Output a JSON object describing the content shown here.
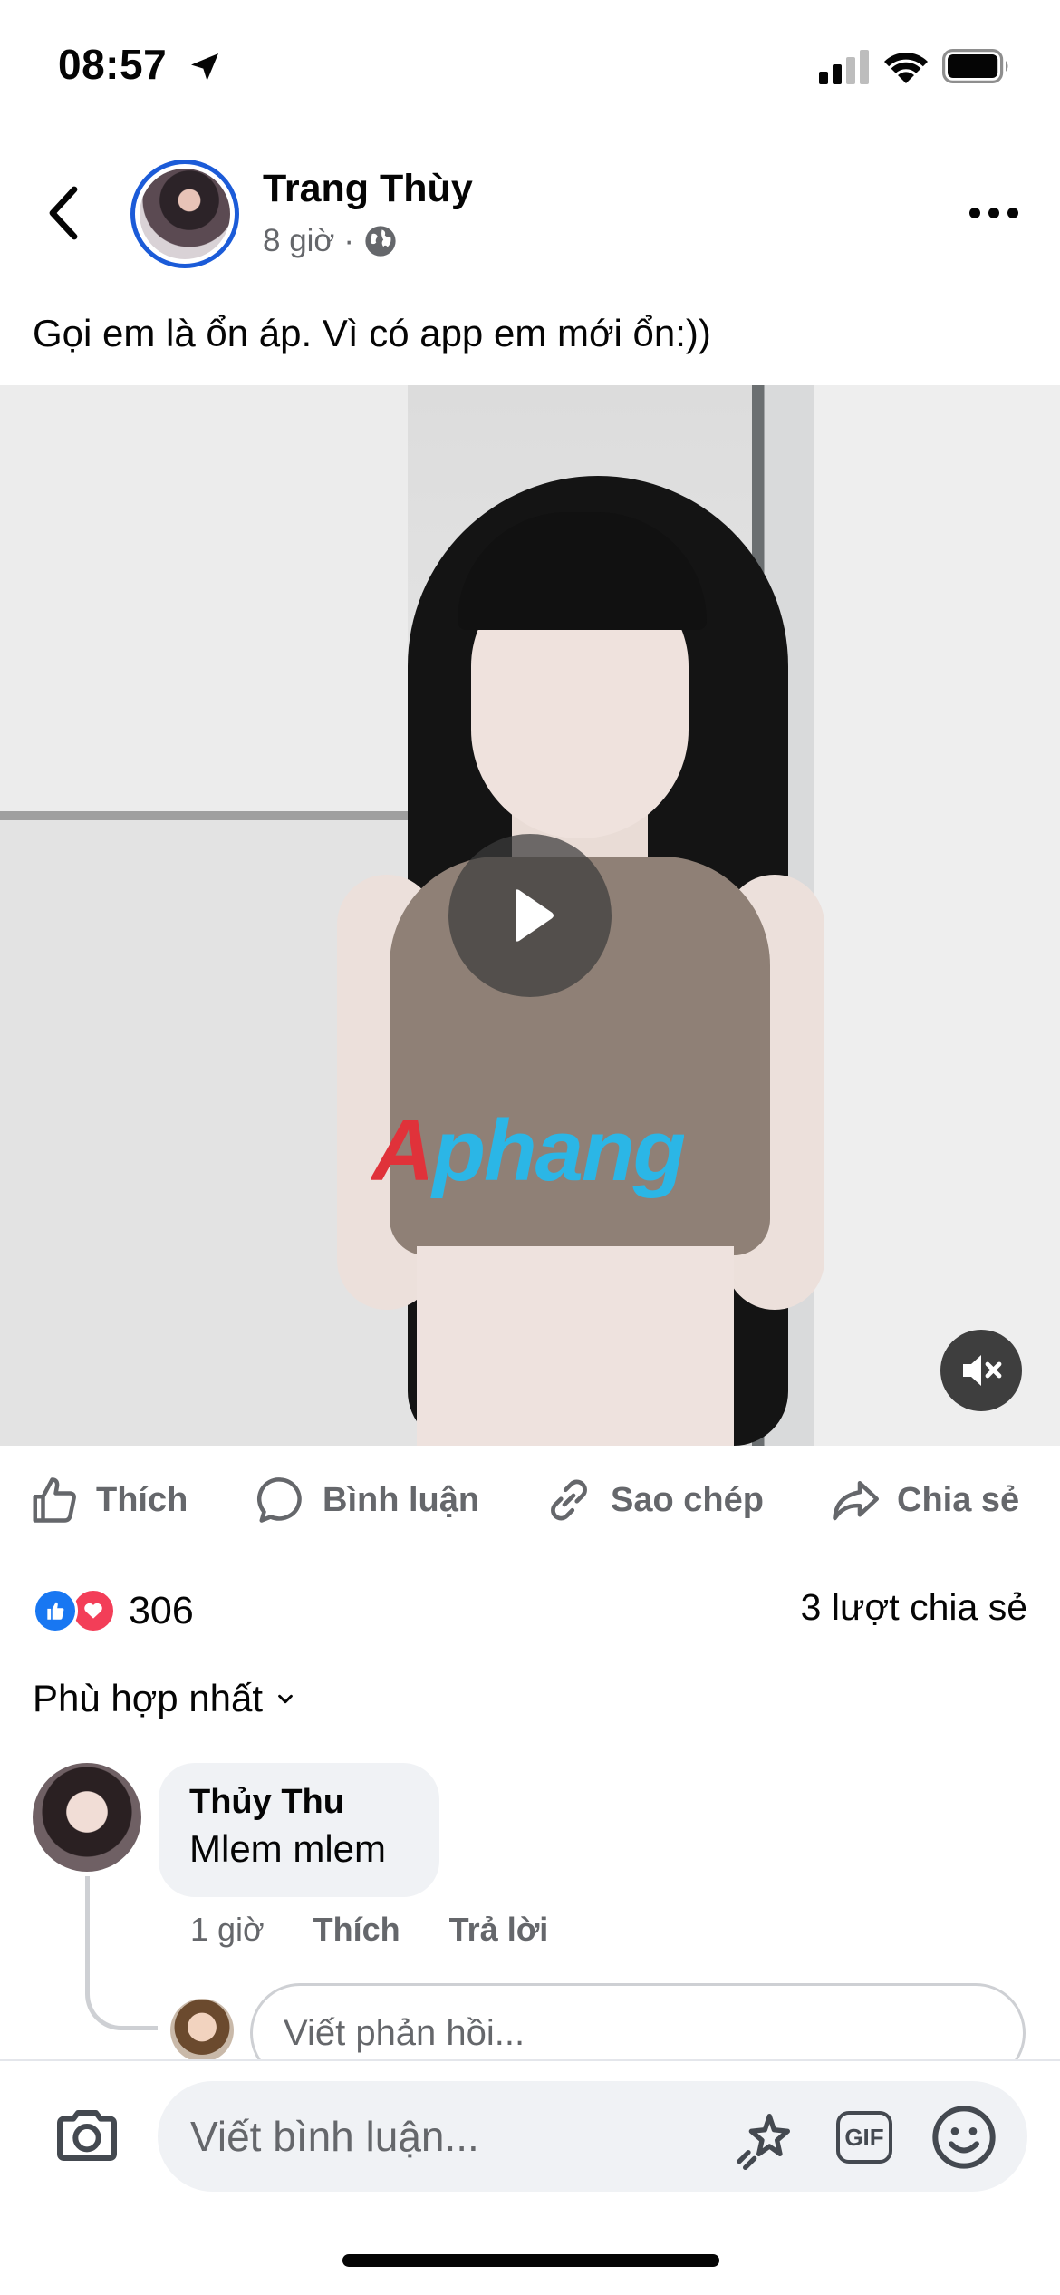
{
  "status_bar": {
    "time": "08:57"
  },
  "header": {
    "author": "Trang Thùy",
    "time_ago": "8 giờ",
    "separator": "·"
  },
  "post": {
    "caption": "Gọi em là ổn áp. Vì có app em mới ổn:))",
    "watermark": "Aphang"
  },
  "actions": {
    "like": "Thích",
    "comment": "Bình luận",
    "copy": "Sao chép",
    "share": "Chia sẻ"
  },
  "stats": {
    "reaction_count": "306",
    "shares": "3 lượt chia sẻ"
  },
  "comments": {
    "sort_label": "Phù hợp nhất",
    "items": [
      {
        "author": "Thủy Thu",
        "text": "Mlem mlem",
        "time": "1 giờ",
        "like": "Thích",
        "reply": "Trả lời"
      }
    ],
    "reply_placeholder": "Viết phản hồi..."
  },
  "composer": {
    "placeholder": "Viết bình luận...",
    "gif_label": "GIF"
  },
  "colors": {
    "accent": "#1877f2",
    "love": "#f33e58",
    "secondary_text": "#65676b",
    "avatar_ring": "#1b5bd8"
  }
}
